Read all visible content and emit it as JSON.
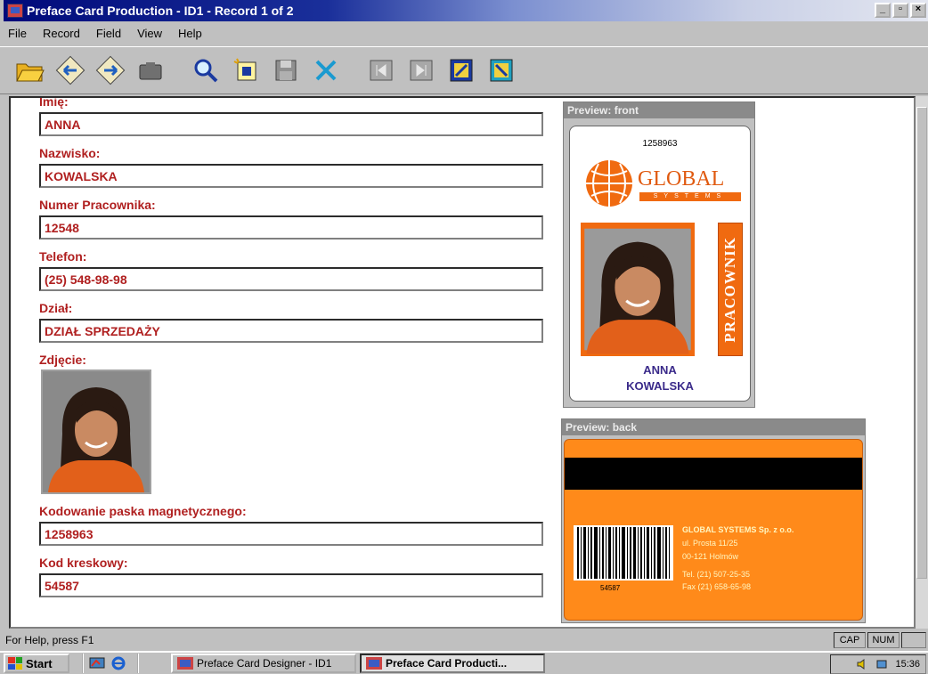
{
  "window": {
    "title": "Preface Card Production - ID1 - Record 1 of 2",
    "min": "_",
    "max": "▫",
    "close": "×"
  },
  "menu": [
    "File",
    "Record",
    "Field",
    "View",
    "Help"
  ],
  "toolbar": {
    "icons": [
      "open-folder-icon",
      "card-back-icon",
      "card-forward-icon",
      "camera-icon",
      "search-icon",
      "new-record-icon",
      "save-icon",
      "delete-icon",
      "first-record-icon",
      "last-record-icon",
      "print-front-icon",
      "print-back-icon"
    ]
  },
  "form": {
    "imie_label": "Imię:",
    "imie_value": "ANNA",
    "nazwisko_label": "Nazwisko:",
    "nazwisko_value": "KOWALSKA",
    "numer_label": "Numer Pracownika:",
    "numer_value": "12548",
    "telefon_label": "Telefon:",
    "telefon_value": "(25) 548-98-98",
    "dzial_label": "Dział:",
    "dzial_value": "DZIAŁ SPRZEDAŻY",
    "zdjecie_label": "Zdjęcie:",
    "kodowanie_label": "Kodowanie paska magnetycznego:",
    "kodowanie_value": "1258963",
    "kod_label": "Kod kreskowy:",
    "kod_value": "54587"
  },
  "preview_front": {
    "title": "Preview: front",
    "number": "1258963",
    "brand": "GLOBAL",
    "brand_sub": "SYSTEMS",
    "badge": "PRACOWNIK",
    "first_name": "ANNA",
    "last_name": "KOWALSKA"
  },
  "preview_back": {
    "title": "Preview: back",
    "barcode_number": "54587",
    "address": [
      "GLOBAL SYSTEMS Sp. z o.o.",
      "ul. Prosta 11/25",
      "00-121 Holmów",
      "Tel. (21) 507-25-35",
      "Fax (21) 658-65-98"
    ]
  },
  "status": {
    "help": "For Help, press F1",
    "cap": "CAP",
    "num": "NUM"
  },
  "taskbar": {
    "start": "Start",
    "task1": "Preface Card Designer - ID1",
    "task2": "Preface Card Producti...",
    "clock": "15:36"
  },
  "colors": {
    "label_red": "#b02020",
    "card_orange": "#ff8a1a",
    "name_purple": "#3a2a8a"
  }
}
